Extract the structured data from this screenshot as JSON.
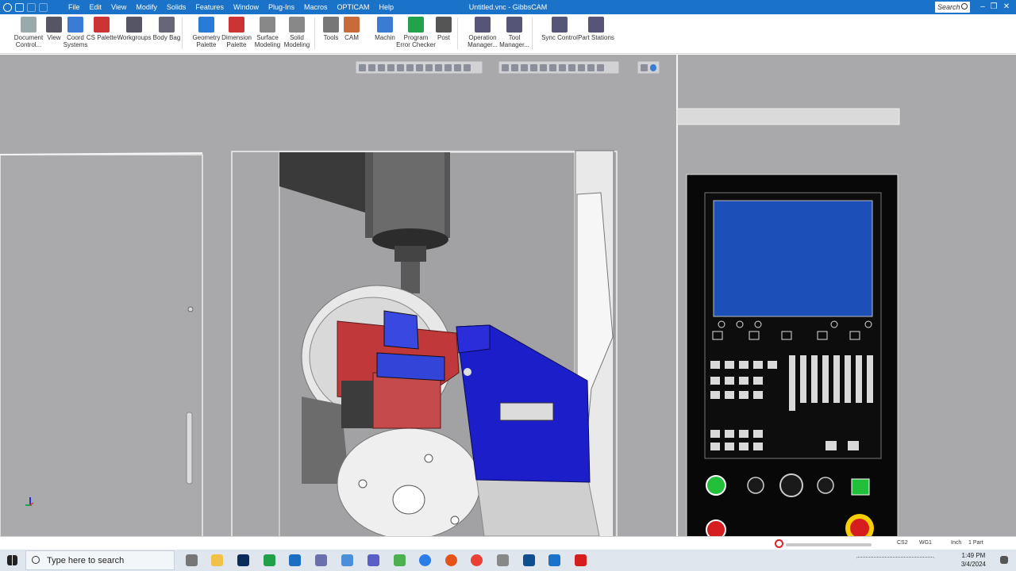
{
  "window": {
    "title": "Untitled.vnc - GibbsCAM",
    "search_placeholder": "Search"
  },
  "menu": [
    "File",
    "Edit",
    "View",
    "Modify",
    "Solids",
    "Features",
    "Window",
    "Plug-Ins",
    "Macros",
    "OPTICAM",
    "Help"
  ],
  "ribbon": {
    "buttons": [
      {
        "label": "Document\nControl...",
        "icon": "document-control-icon"
      },
      {
        "label": "View",
        "icon": "view-icon"
      },
      {
        "label": "Coord\nSystems",
        "icon": "coord-systems-icon"
      },
      {
        "label": "CS Palette",
        "icon": "cs-palette-icon"
      },
      {
        "label": "Workgroups",
        "icon": "workgroups-icon"
      },
      {
        "label": "Body Bag",
        "icon": "body-bag-icon"
      },
      {
        "label": "Geometry\nPalette",
        "icon": "geometry-palette-icon"
      },
      {
        "label": "Dimension\nPalette",
        "icon": "dimension-palette-icon"
      },
      {
        "label": "Surface\nModeling",
        "icon": "surface-modeling-icon"
      },
      {
        "label": "Solid\nModeling",
        "icon": "solid-modeling-icon"
      },
      {
        "label": "Tools",
        "icon": "tools-icon"
      },
      {
        "label": "CAM",
        "icon": "cam-icon"
      },
      {
        "label": "Machin",
        "icon": "machine-icon"
      },
      {
        "label": "Program\nError Checker",
        "icon": "check-icon"
      },
      {
        "label": "Post",
        "icon": "post-icon"
      },
      {
        "label": "Operation\nManager...",
        "icon": "operation-manager-icon"
      },
      {
        "label": "Tool\nManager...",
        "icon": "tool-manager-icon"
      },
      {
        "label": "Sync Control",
        "icon": "sync-control-icon"
      },
      {
        "label": "Part Stations",
        "icon": "part-stations-icon"
      }
    ]
  },
  "status": {
    "cs": "CS2",
    "wg": "WG1",
    "units": "Inch",
    "parts": "1 Part"
  },
  "taskbar": {
    "search_placeholder": "Type here to search",
    "time": "1:49 PM",
    "date": "3/4/2024"
  },
  "colors": {
    "accent": "#1b72c9",
    "part_red": "#c0383a",
    "fixture_blue": "#1c1fc9",
    "screen_blue": "#1d4fb8",
    "go_green": "#22c03a",
    "stop_red": "#d71e1e"
  }
}
